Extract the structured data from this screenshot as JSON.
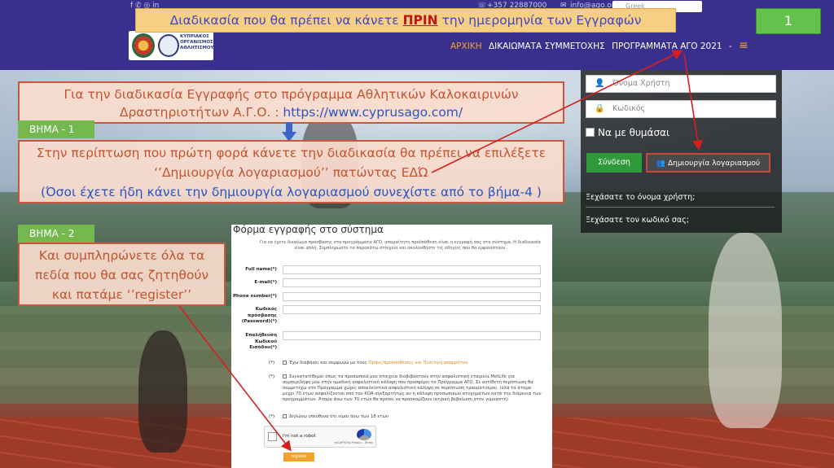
{
  "header": {
    "banner_prefix": "Διαδικασία που θα πρέπει να κάνετε ",
    "banner_emph": "ΠΡΙΝ",
    "banner_suffix": " την ημερομηνία των Εγγραφών",
    "slide_number": "1",
    "contact_phone": "+357 22887000",
    "contact_email": "info@ago.org.cy",
    "search_placeholder": "Greek",
    "logo_text": "ΚΥΠΡΙΑΚΟΣ ΟΡΓΑΝΙΣΜΟΣ ΑΘΛΗΤΙΣΜΟΥ"
  },
  "nav": {
    "items": [
      "ΑΡΧΙΚΗ",
      "ΔΙΚΑΙΩΜΑΤΑ ΣΥΜΜΕΤΟΧΗΣ",
      "ΠΡΟΓΡΑΜΜΑΤΑ ΑΓΟ 2021",
      "-"
    ],
    "menu_icon": "≡"
  },
  "callouts": {
    "intro_line1": "Για την διαδικασία Εγγραφής στο πρόγραμμα Αθλητικών Καλοκαιρινών",
    "intro_line2": "Δραστηριοτήτων  Α.Γ.Ο. : ",
    "intro_link": "https://www.cyprusago.com/",
    "step1_label": "ΒΗΜΑ - 1",
    "step1_line1": "Στην περίπτωση που πρώτη φορά κάνετε την διαδικασία θα πρέπει να επιλέξετε",
    "step1_line2": "‘’Δημιουργία λογαριασμού’’ πατώντας ΕΔΏ",
    "step1_line3": "(Όσοι έχετε ήδη κάνει την δημιουργία λογαριασμού συνεχίστε από το βήμα-4 )",
    "step2_label": "ΒΗΜΑ - 2",
    "step2_line1": "Και συμπληρώνετε όλα τα",
    "step2_line2": "πεδία που θα σας ζητηθούν",
    "step2_line3": "και πατάμε ‘’register’’"
  },
  "login": {
    "username_placeholder": "Όνομα Χρήστη",
    "password_placeholder": "Κωδικός",
    "remember_label": "Να με θυμάσαι",
    "login_button": "Σύνδεση",
    "create_account_button": "Δημιουργία λογαριασμού",
    "forgot_username": "Ξεχάσατε το όνομα χρήστη;",
    "forgot_password": "Ξεχάσατε τον κωδικό σας;"
  },
  "form": {
    "title": "Φόρμα εγγραφής στο σύστημα",
    "intro": "Για να έχετε δικαίωμα πρόσβασης στο προγράμματα ΑΓΟ, απαραίτητη προϋπόθεση είναι η εγγραφή σας στο σύστημα. Η διαδικασία είναι απλή. Συμπληρώστε τα παρακάτω στοιχεία και ακολουθήστε τις οδηγίες που θα εμφανιστούν.",
    "fields": [
      {
        "label": "Full name(*)"
      },
      {
        "label": "E-mail(*)"
      },
      {
        "label": "Phone number(*)"
      },
      {
        "label": "Κωδικός πρόσβασης (Password)(*)"
      },
      {
        "label": "Επαλήθευση Κωδικού Εισόδου(*)"
      }
    ],
    "required_mark": "(*)",
    "check_terms_prefix": "Έχω διαβάσει και συμφωνώ με τους ",
    "check_terms_link": "Όρους/προϋποθέσεις και Πολιτική απορρήτου",
    "check_insurance": "Συγκατατίθεμαι όπως τα προσωπικά μου στοιχεία διαβιβαστούν στην ασφαλιστική εταιρεία MetLife για συμπερίληψη μου στην ομαδική ασφαλιστική κάλυψη που προσφέρει το Πρόγραμμα ΑΓΟ. Σε αντίθετη περίπτωση θα συμμετέχω στο Πρόγραμμα χωρίς αποκλειστικά ασφαλιστική κάλυψη σε περίπτωση τραυματισμού. (όλα τα άτομα μέχρι 70 ετών ασφαλίζονται από τον ΚΟΑ ανεξαρτήτως αν η κάλυψη προσωπικών ατυχημάτων κατά την διάρκεια των προγραμμάτων. Άτομα άνω των 70 ετών θα πρέπει να προσκομίζουν ιατρική βεβαίωση στον γυμναστή)",
    "check_age": "Δηλώνω υπεύθυνα ότι είμαι άνω των 18 ετών",
    "captcha_text": "I'm not a robot",
    "captcha_brand": "reCAPTCHA Privacy - Terms",
    "register_button": "register"
  },
  "colors": {
    "topbar": "#3a2f8c",
    "banner_bg": "#f7cf83",
    "accent_orange": "#f0a42b",
    "callout_border": "#c8583d",
    "step_green": "#75b84f",
    "login_green": "#2f9a3a"
  },
  "icons": {
    "user": "user-icon",
    "lock": "lock-icon",
    "add_user": "add-user-icon",
    "phone": "phone-icon",
    "email": "email-icon",
    "menu": "hamburger-menu-icon"
  }
}
